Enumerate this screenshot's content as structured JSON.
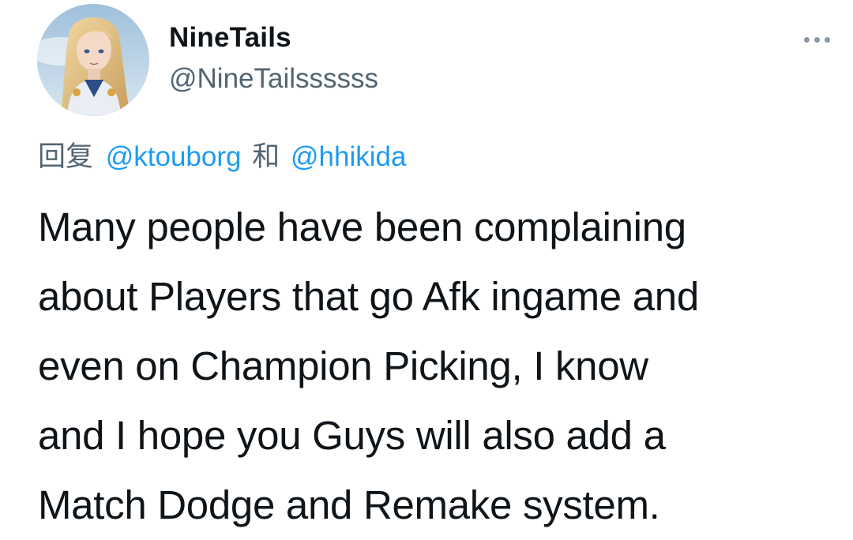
{
  "author": {
    "display_name": "NineTails",
    "handle": "@NineTailssssss",
    "avatar": "profile-avatar"
  },
  "more_icon": "more-horizontal-icon",
  "reply": {
    "prefix": "回复",
    "mentions": [
      "@ktouborg",
      "@hhikida"
    ],
    "conjunction": "和"
  },
  "tweet": {
    "lines": [
      "Many people have been complaining",
      "about Players that go Afk ingame and",
      "even on Champion Picking, I know",
      "and I hope you Guys will also add a",
      "Match Dodge and Remake system."
    ]
  },
  "colors": {
    "link": "#1d9bf0",
    "muted": "#536471",
    "text": "#0f1419"
  }
}
